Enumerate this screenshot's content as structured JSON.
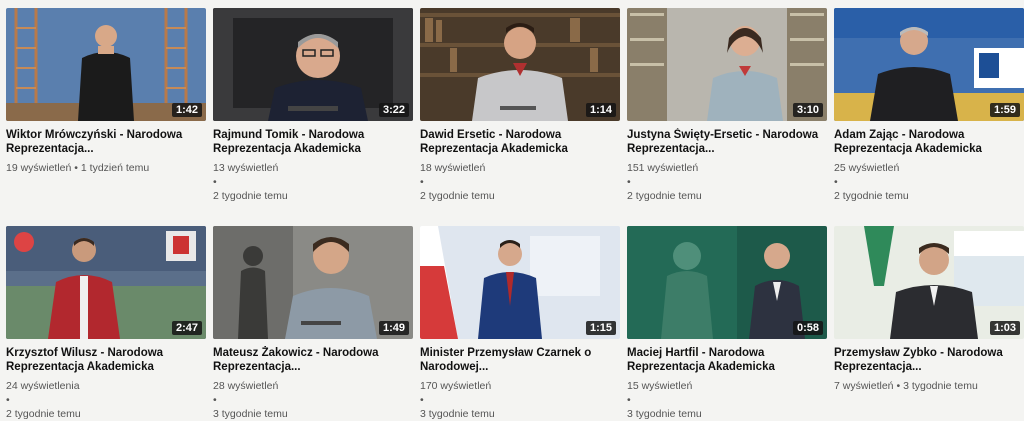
{
  "videos": [
    {
      "title": "Wiktor Mrówczyński - Narodowa Reprezentacja...",
      "duration": "1:42",
      "views": "19 wyświetleń",
      "age": "1 tydzień temu"
    },
    {
      "title": "Rajmund Tomik - Narodowa Reprezentacja Akademicka",
      "duration": "3:22",
      "views": "13 wyświetleń",
      "age": "2 tygodnie temu"
    },
    {
      "title": "Dawid Ersetic - Narodowa Reprezentacja Akademicka",
      "duration": "1:14",
      "views": "18 wyświetleń",
      "age": "2 tygodnie temu"
    },
    {
      "title": "Justyna Święty-Ersetic - Narodowa Reprezentacja...",
      "duration": "3:10",
      "views": "151 wyświetleń",
      "age": "2 tygodnie temu"
    },
    {
      "title": "Adam Zając - Narodowa Reprezentacja Akademicka",
      "duration": "1:59",
      "views": "25 wyświetleń",
      "age": "2 tygodnie temu"
    },
    {
      "title": "Krzysztof Wilusz - Narodowa Reprezentacja Akademicka",
      "duration": "2:47",
      "views": "24 wyświetlenia",
      "age": "2 tygodnie temu"
    },
    {
      "title": "Mateusz Żakowicz - Narodowa Reprezentacja...",
      "duration": "1:49",
      "views": "28 wyświetleń",
      "age": "3 tygodnie temu"
    },
    {
      "title": "Minister Przemysław Czarnek o Narodowej...",
      "duration": "1:15",
      "views": "170 wyświetleń",
      "age": "3 tygodnie temu"
    },
    {
      "title": "Maciej Hartfil - Narodowa Reprezentacja Akademicka",
      "duration": "0:58",
      "views": "15 wyświetleń",
      "age": "3 tygodnie temu"
    },
    {
      "title": "Przemysław Zybko - Narodowa Reprezentacja...",
      "duration": "1:03",
      "views": "7 wyświetleń",
      "age": "3 tygodnie temu"
    }
  ],
  "separator": "•"
}
